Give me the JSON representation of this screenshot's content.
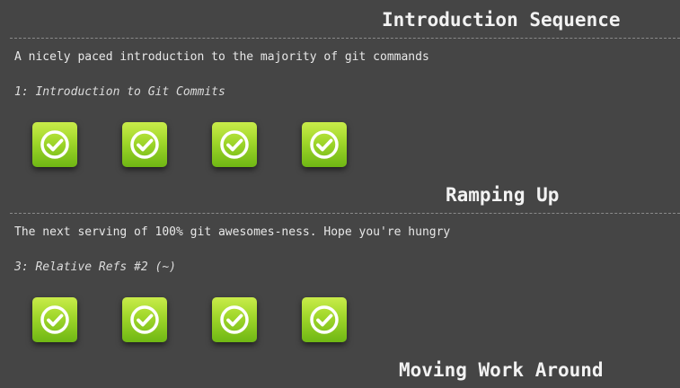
{
  "sections": [
    {
      "title": "Introduction Sequence",
      "about": "A nicely paced introduction to the majority of git commands",
      "level_name": "1: Introduction to Git Commits",
      "levels": [
        {
          "icon": "checkmark-icon",
          "status": "complete"
        },
        {
          "icon": "checkmark-icon",
          "status": "complete"
        },
        {
          "icon": "checkmark-icon",
          "status": "complete"
        },
        {
          "icon": "checkmark-icon",
          "status": "complete"
        }
      ]
    },
    {
      "title": "Ramping Up",
      "about": "The next serving of 100% git awesomes-ness. Hope you're hungry",
      "level_name": "3: Relative Refs #2 (~)",
      "levels": [
        {
          "icon": "checkmark-icon",
          "status": "complete"
        },
        {
          "icon": "checkmark-icon",
          "status": "complete"
        },
        {
          "icon": "checkmark-icon",
          "status": "complete"
        },
        {
          "icon": "checkmark-icon",
          "status": "complete"
        }
      ]
    },
    {
      "title": "Moving Work Around"
    }
  ],
  "colors": {
    "background": "#454545",
    "complete_icon_top": "#c9ec4a",
    "complete_icon_bottom": "#6fb714"
  }
}
